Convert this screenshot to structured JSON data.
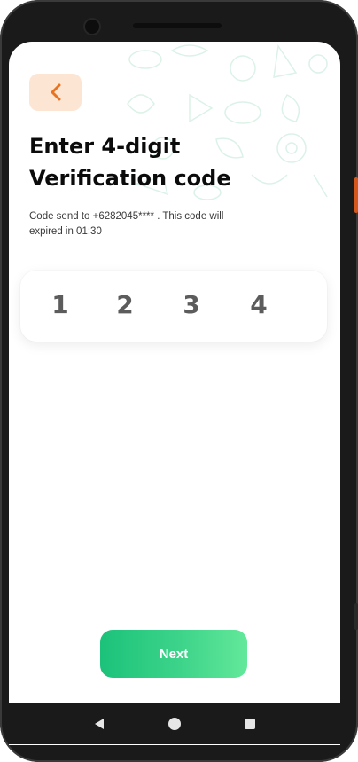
{
  "header": {
    "back_icon": "chevron-left-icon",
    "title_line1": "Enter 4-digit",
    "title_line2": "Verification code"
  },
  "message": {
    "line1": "Code send to +6282045**** . This code will",
    "line2": "expired in 01:30"
  },
  "code": {
    "digits": [
      "1",
      "2",
      "3",
      "4"
    ]
  },
  "actions": {
    "next_label": "Next"
  },
  "navbar": {
    "icons": [
      "back-triangle-icon",
      "home-circle-icon",
      "recents-square-icon"
    ]
  },
  "colors": {
    "accent_orange": "#e8721f",
    "back_bg": "#fde5d4",
    "next_gradient_start": "#1cc27a",
    "next_gradient_end": "#63e89a",
    "digit_color": "#5c5c5c"
  }
}
